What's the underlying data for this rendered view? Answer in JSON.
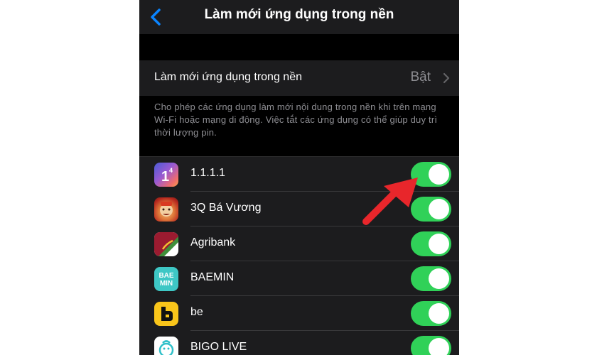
{
  "navbar": {
    "title": "Làm mới ứng dụng trong nền",
    "back_icon": "chevron-left-icon"
  },
  "setting": {
    "label": "Làm mới ứng dụng trong nền",
    "value": "Bật",
    "icon": "chevron-right-icon"
  },
  "footer_note": "Cho phép các ứng dụng làm mới nội dung trong nền khi trên mạng Wi-Fi hoặc mạng di động. Việc tắt các ứng dụng có thể giúp duy trì thời lượng pin.",
  "apps": [
    {
      "name": "1.1.1.1",
      "icon_text": "1",
      "icon_sup": "4",
      "enabled": true
    },
    {
      "name": "3Q Bá Vương",
      "enabled": true
    },
    {
      "name": "Agribank",
      "enabled": true
    },
    {
      "name": "BAEMIN",
      "icon_text": "BAE MIN",
      "enabled": true
    },
    {
      "name": "be",
      "enabled": true
    },
    {
      "name": "BIGO LIVE",
      "enabled": true
    }
  ],
  "colors": {
    "accent_blue": "#0a84ff",
    "toggle_on": "#30d158",
    "annotation_arrow": "#e8262b"
  }
}
